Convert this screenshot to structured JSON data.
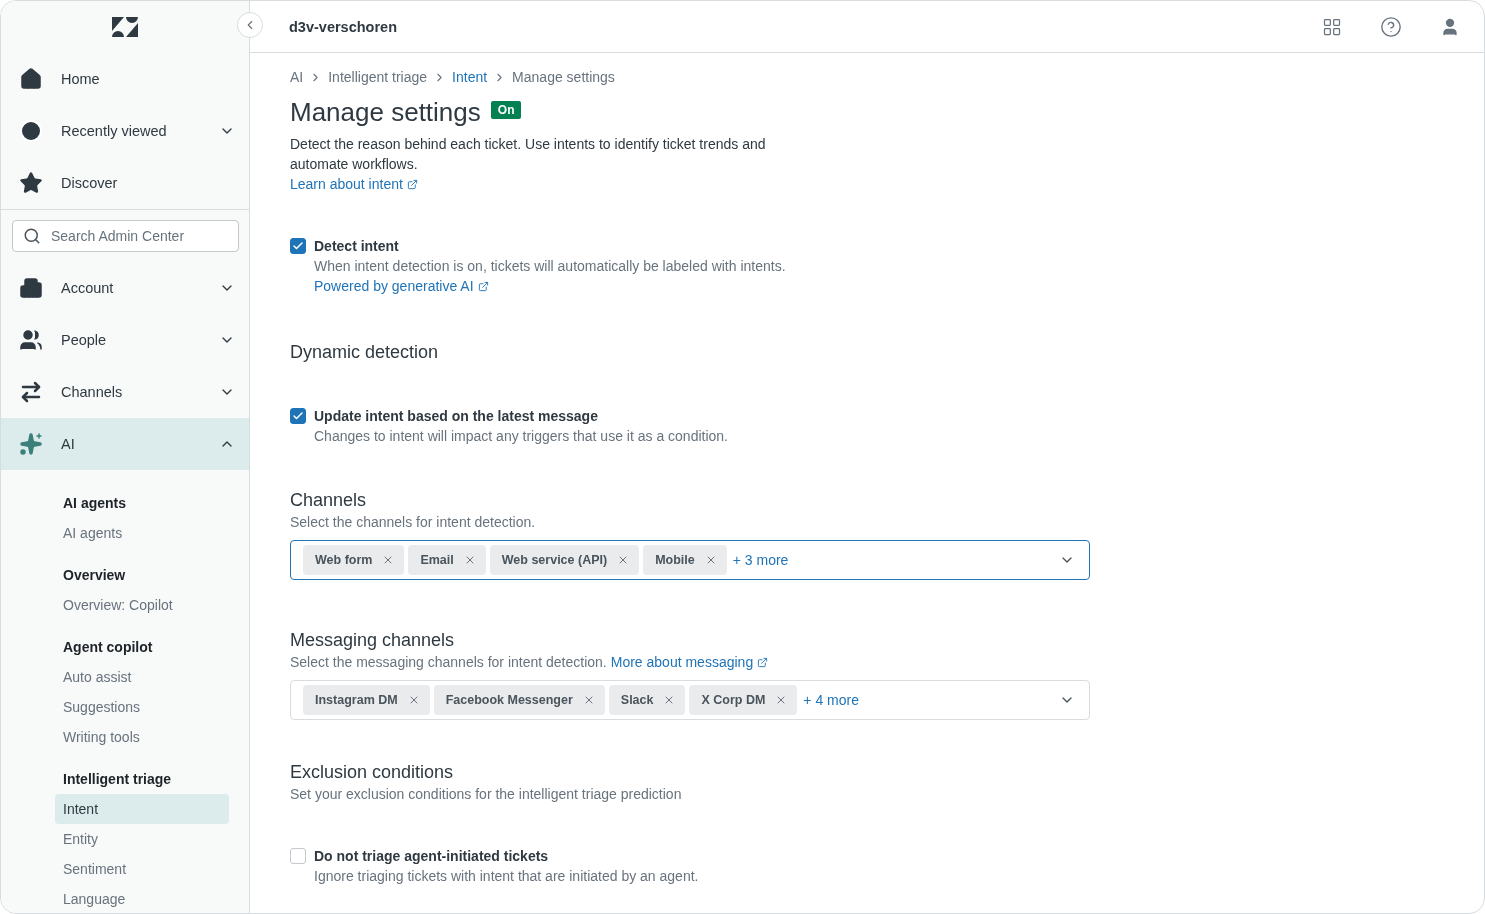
{
  "sidebar": {
    "top_items": [
      {
        "label": "Home",
        "expandable": false
      },
      {
        "label": "Recently viewed",
        "expandable": true,
        "expanded": false
      },
      {
        "label": "Discover",
        "expandable": false
      }
    ],
    "search": {
      "placeholder": "Search Admin Center"
    },
    "nav_items": [
      {
        "label": "Account",
        "expanded": false,
        "selected": false
      },
      {
        "label": "People",
        "expanded": false,
        "selected": false
      },
      {
        "label": "Channels",
        "expanded": false,
        "selected": false
      },
      {
        "label": "AI",
        "expanded": true,
        "selected": true
      }
    ],
    "groups": [
      {
        "heading": "AI agents",
        "items": [
          {
            "label": "AI agents",
            "selected": false
          }
        ]
      },
      {
        "heading": "Overview",
        "items": [
          {
            "label": "Overview: Copilot",
            "selected": false
          }
        ]
      },
      {
        "heading": "Agent copilot",
        "items": [
          {
            "label": "Auto assist",
            "selected": false
          },
          {
            "label": "Suggestions",
            "selected": false
          },
          {
            "label": "Writing tools",
            "selected": false
          }
        ]
      },
      {
        "heading": "Intelligent triage",
        "items": [
          {
            "label": "Intent",
            "selected": true
          },
          {
            "label": "Entity",
            "selected": false
          },
          {
            "label": "Sentiment",
            "selected": false
          },
          {
            "label": "Language",
            "selected": false
          }
        ]
      }
    ]
  },
  "header": {
    "title": "d3v-verschoren"
  },
  "breadcrumb": [
    {
      "label": "AI",
      "link": false
    },
    {
      "label": "Intelligent triage",
      "link": false
    },
    {
      "label": "Intent",
      "link": true
    },
    {
      "label": "Manage settings",
      "link": false
    }
  ],
  "page": {
    "title": "Manage settings",
    "badge": "On",
    "description": "Detect the reason behind each ticket. Use intents to identify ticket trends and automate workflows.",
    "link": "Learn about intent"
  },
  "sections": [
    {
      "kind": "checkbox",
      "label": "Detect intent",
      "checked": true,
      "description": "When intent detection is on, tickets will automatically be labeled with intents.",
      "link": "Powered by generative AI"
    },
    {
      "kind": "heading",
      "title": "Dynamic detection"
    },
    {
      "kind": "checkbox",
      "label": "Update intent based on the latest message",
      "checked": true,
      "description": "Changes to intent will impact any triggers that use it as a condition."
    },
    {
      "kind": "select",
      "title": "Channels",
      "description": "Select the channels for intent detection.",
      "focused": true,
      "tags": [
        "Web form",
        "Email",
        "Web service (API)",
        "Mobile"
      ],
      "more": "+ 3 more"
    },
    {
      "kind": "select",
      "title": "Messaging channels",
      "description": "Select the messaging channels for intent detection.",
      "link": "More about messaging",
      "focused": false,
      "tags": [
        "Instagram DM",
        "Facebook Messenger",
        "Slack",
        "X Corp DM"
      ],
      "more": "+ 4 more"
    },
    {
      "kind": "heading",
      "title": "Exclusion conditions",
      "description": "Set your exclusion conditions for the intelligent triage prediction"
    },
    {
      "kind": "checkbox",
      "label": "Do not triage agent-initiated tickets",
      "checked": false,
      "description": "Ignore triaging tickets with intent that are initiated by an agent."
    }
  ]
}
